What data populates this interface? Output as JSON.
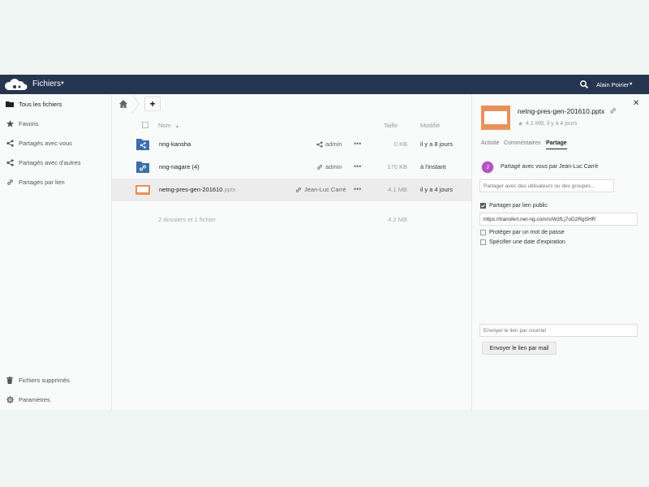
{
  "header": {
    "app_name": "Fichiers",
    "user_name": "Alain Poirier"
  },
  "sidebar": {
    "items": [
      {
        "label": "Tous les fichiers",
        "icon": "folder-icon"
      },
      {
        "label": "Favoris",
        "icon": "star-icon"
      },
      {
        "label": "Partagés avec vous",
        "icon": "share-icon"
      },
      {
        "label": "Partagés avec d'autres",
        "icon": "share-icon"
      },
      {
        "label": "Partagés par lien",
        "icon": "link-icon"
      }
    ],
    "bottom": [
      {
        "label": "Fichiers supprimés",
        "icon": "trash-icon"
      },
      {
        "label": "Paramètres",
        "icon": "gear-icon"
      }
    ]
  },
  "files": {
    "columns": {
      "name": "Nom",
      "name_sort": "▲",
      "size": "Taille",
      "modified": "Modifié"
    },
    "rows": [
      {
        "name": "nng-kansha",
        "ext": "",
        "share": "admin",
        "share_icon": "share-icon",
        "size": "0 KB",
        "modified": "il y a 8 jours",
        "type": "shared-folder"
      },
      {
        "name": "nng-nagare (4)",
        "ext": "",
        "share": "admin",
        "share_icon": "link-icon",
        "size": "170 KB",
        "modified": "à l'instant",
        "type": "link-folder"
      },
      {
        "name": "netng-pres-gen-201610",
        "ext": ".pptx",
        "share": "Jean-Luc Carré",
        "share_icon": "link-icon",
        "size": "4.1 MB",
        "modified": "il y a 4 jours",
        "type": "presentation"
      }
    ],
    "summary": "2 dossiers et 1 fichier",
    "summary_size": "4.2 MB",
    "more_label": "•••"
  },
  "details": {
    "file_name": "netng-pres-gen-201610.pptx",
    "meta": "4.1 MB, il y a 4 jours",
    "tabs": [
      "Activité",
      "Commentaires",
      "Partage"
    ],
    "active_tab": "Partage",
    "avatar_letter": "J",
    "shared_by": "Partagé avec vous par Jean-Luc Carré",
    "share_placeholder": "Partager avec des utilisateurs ou des groupes...",
    "public_link_label": "Partager par lien public",
    "public_link_checked": true,
    "link_url": "https://transfert.net-ng.com/s/WzfLj7oD2RgSHR",
    "password_label": "Protéger par un mot de passe",
    "expiry_label": "Spécifier une date d'expiration",
    "email_placeholder": "Envoyer le lien par courriel",
    "send_button": "Envoyer le lien par mail"
  },
  "colors": {
    "header_bg": "#263550",
    "folder_blue": "#3c6fa9",
    "pptx_orange": "#e9915a",
    "avatar_purple": "#b84fc4"
  }
}
